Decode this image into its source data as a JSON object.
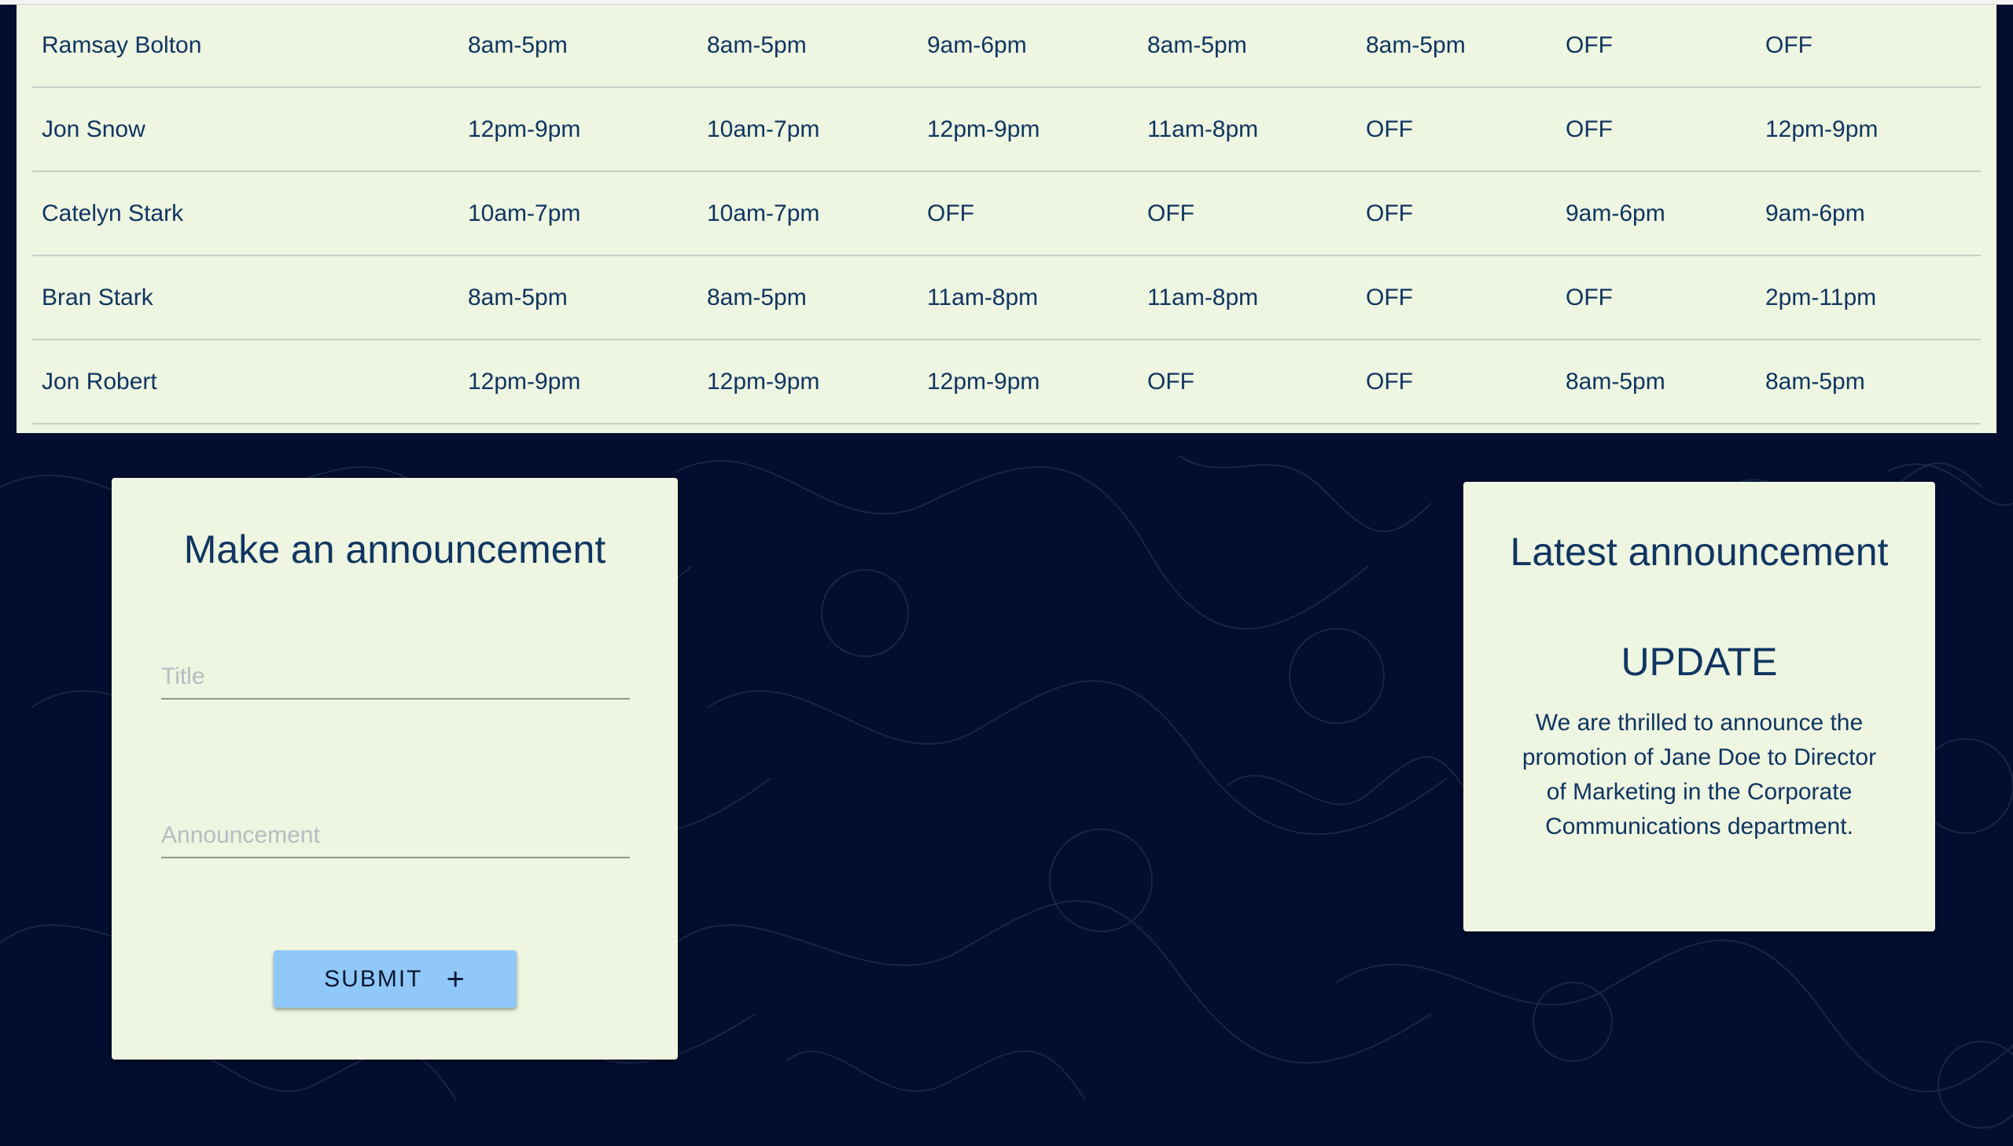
{
  "schedule": {
    "rows": [
      {
        "name": "Ramsay Bolton",
        "shifts": [
          "8am-5pm",
          "8am-5pm",
          "9am-6pm",
          "8am-5pm",
          "8am-5pm",
          "OFF",
          "OFF"
        ]
      },
      {
        "name": "Jon Snow",
        "shifts": [
          "12pm-9pm",
          "10am-7pm",
          "12pm-9pm",
          "11am-8pm",
          "OFF",
          "OFF",
          "12pm-9pm"
        ]
      },
      {
        "name": "Catelyn Stark",
        "shifts": [
          "10am-7pm",
          "10am-7pm",
          "OFF",
          "OFF",
          "OFF",
          "9am-6pm",
          "9am-6pm"
        ]
      },
      {
        "name": "Bran Stark",
        "shifts": [
          "8am-5pm",
          "8am-5pm",
          "11am-8pm",
          "11am-8pm",
          "OFF",
          "OFF",
          "2pm-11pm"
        ]
      },
      {
        "name": "Jon Robert",
        "shifts": [
          "12pm-9pm",
          "12pm-9pm",
          "12pm-9pm",
          "OFF",
          "OFF",
          "8am-5pm",
          "8am-5pm"
        ]
      }
    ]
  },
  "make_announcement": {
    "heading": "Make an announcement",
    "title_placeholder": "Title",
    "announcement_placeholder": "Announcement",
    "submit_label": "SUBMIT",
    "submit_icon": "plus-icon"
  },
  "latest_announcement": {
    "heading": "Latest announcement",
    "title": "UPDATE",
    "body": "We are thrilled to announce the promotion of Jane Doe to Director of Marketing in the Corporate Communications department."
  },
  "colors": {
    "page_background": "#020d2f",
    "panel_background": "#eef5e0",
    "text": "#0f3562",
    "submit_button": "#90c9f9"
  }
}
